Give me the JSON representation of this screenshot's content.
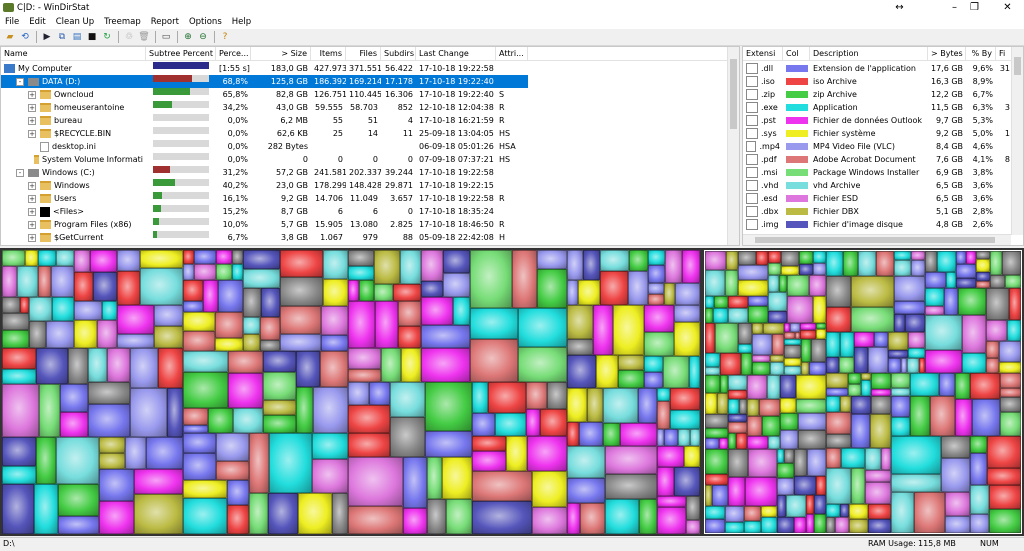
{
  "window": {
    "title": "C|D: - WinDirStat"
  },
  "menu": [
    "File",
    "Edit",
    "Clean Up",
    "Treemap",
    "Report",
    "Options",
    "Help"
  ],
  "toolbar_icons": [
    "open-icon",
    "refresh-icon",
    "select-icon",
    "copy-path-icon",
    "explorer-icon",
    "command-prompt-icon",
    "refresh-selected-icon",
    "recycle-icon",
    "delete-icon",
    "properties-icon",
    "zoom-in-icon",
    "zoom-out-icon",
    "help-icon"
  ],
  "tree": {
    "columns": [
      "Name",
      "Subtree Percent",
      "Perce...",
      "> Size",
      "Items",
      "Files",
      "Subdirs",
      "Last Change",
      "Attri..."
    ],
    "rows": [
      {
        "name": "My Computer",
        "indent": 0,
        "expander": "",
        "icon": "computer-icon",
        "bar_color": "#2b2b8c",
        "bar_pct": 100,
        "percent": "[1:55 s]",
        "size": "183,0 GB",
        "items": "427.973",
        "files": "371.551",
        "subdirs": "56.422",
        "last_change": "17-10-18 19:22:58",
        "attr": ""
      },
      {
        "name": "DATA (D:)",
        "indent": 1,
        "expander": "-",
        "icon": "drive-icon",
        "bar_color": "#a03030",
        "bar_pct": 69,
        "percent": "68,8%",
        "size": "125,8 GB",
        "items": "186.392",
        "files": "169.214",
        "subdirs": "17.178",
        "last_change": "17-10-18 19:22:40",
        "attr": "",
        "selected": true
      },
      {
        "name": "Owncloud",
        "indent": 2,
        "expander": "+",
        "icon": "cloud-folder-icon",
        "bar_color": "#3a9a3a",
        "bar_pct": 66,
        "percent": "65,8%",
        "size": "82,8 GB",
        "items": "126.751",
        "files": "110.445",
        "subdirs": "16.306",
        "last_change": "17-10-18 19:22:40",
        "attr": "S"
      },
      {
        "name": "homeuserantoine",
        "indent": 2,
        "expander": "+",
        "icon": "user-folder-icon",
        "bar_color": "#3a9a3a",
        "bar_pct": 34,
        "percent": "34,2%",
        "size": "43,0 GB",
        "items": "59.555",
        "files": "58.703",
        "subdirs": "852",
        "last_change": "12-10-18 12:04:38",
        "attr": "R"
      },
      {
        "name": "bureau",
        "indent": 2,
        "expander": "+",
        "icon": "desktop-folder-icon",
        "bar_color": "#3a9a3a",
        "bar_pct": 0,
        "percent": "0,0%",
        "size": "6,2 MB",
        "items": "55",
        "files": "51",
        "subdirs": "4",
        "last_change": "17-10-18 16:21:59",
        "attr": "R"
      },
      {
        "name": "$RECYCLE.BIN",
        "indent": 2,
        "expander": "+",
        "icon": "folder-icon",
        "bar_color": "#3a9a3a",
        "bar_pct": 0,
        "percent": "0,0%",
        "size": "62,6 KB",
        "items": "25",
        "files": "14",
        "subdirs": "11",
        "last_change": "25-09-18 13:04:05",
        "attr": "HS"
      },
      {
        "name": "desktop.ini",
        "indent": 2,
        "expander": "",
        "icon": "file-icon",
        "bar_color": "#3a9a3a",
        "bar_pct": 0,
        "percent": "0,0%",
        "size": "282 Bytes",
        "items": "",
        "files": "",
        "subdirs": "",
        "last_change": "06-09-18 05:01:26",
        "attr": "HSA"
      },
      {
        "name": "System Volume Informati",
        "indent": 2,
        "expander": "",
        "icon": "folder-icon",
        "bar_color": "#3a9a3a",
        "bar_pct": 0,
        "percent": "0,0%",
        "size": "0",
        "items": "0",
        "files": "0",
        "subdirs": "0",
        "last_change": "07-09-18 07:37:21",
        "attr": "HS"
      },
      {
        "name": "Windows (C:)",
        "indent": 1,
        "expander": "-",
        "icon": "drive-icon",
        "bar_color": "#a03030",
        "bar_pct": 31,
        "percent": "31,2%",
        "size": "57,2 GB",
        "items": "241.581",
        "files": "202.337",
        "subdirs": "39.244",
        "last_change": "17-10-18 19:22:58",
        "attr": ""
      },
      {
        "name": "Windows",
        "indent": 2,
        "expander": "+",
        "icon": "folder-icon",
        "bar_color": "#3a9a3a",
        "bar_pct": 40,
        "percent": "40,2%",
        "size": "23,0 GB",
        "items": "178.299",
        "files": "148.428",
        "subdirs": "29.871",
        "last_change": "17-10-18 19:22:15",
        "attr": ""
      },
      {
        "name": "Users",
        "indent": 2,
        "expander": "+",
        "icon": "folder-icon",
        "bar_color": "#3a9a3a",
        "bar_pct": 16,
        "percent": "16,1%",
        "size": "9,2 GB",
        "items": "14.706",
        "files": "11.049",
        "subdirs": "3.657",
        "last_change": "17-10-18 19:22:58",
        "attr": "R"
      },
      {
        "name": "<Files>",
        "indent": 2,
        "expander": "+",
        "icon": "files-icon",
        "bar_color": "#3a9a3a",
        "bar_pct": 15,
        "percent": "15,2%",
        "size": "8,7 GB",
        "items": "6",
        "files": "6",
        "subdirs": "0",
        "last_change": "17-10-18 18:35:24",
        "attr": ""
      },
      {
        "name": "Program Files (x86)",
        "indent": 2,
        "expander": "+",
        "icon": "folder-icon",
        "bar_color": "#3a9a3a",
        "bar_pct": 10,
        "percent": "10,0%",
        "size": "5,7 GB",
        "items": "15.905",
        "files": "13.080",
        "subdirs": "2.825",
        "last_change": "17-10-18 18:46:50",
        "attr": "R"
      },
      {
        "name": "$GetCurrent",
        "indent": 2,
        "expander": "+",
        "icon": "folder-icon",
        "bar_color": "#3a9a3a",
        "bar_pct": 7,
        "percent": "6,7%",
        "size": "3,8 GB",
        "items": "1.067",
        "files": "979",
        "subdirs": "88",
        "last_change": "05-09-18 22:42:08",
        "attr": "H"
      }
    ]
  },
  "extensions": {
    "columns": [
      "Extensi",
      "Col",
      "Description",
      "> Bytes",
      "% By",
      "Fi"
    ],
    "rows": [
      {
        "ext": ".dll",
        "color": "#7777ee",
        "desc": "Extension de l'application",
        "bytes": "17,6 GB",
        "pct": "9,6%",
        "files": "31"
      },
      {
        "ext": ".iso",
        "color": "#ee4444",
        "desc": "iso Archive",
        "bytes": "16,3 GB",
        "pct": "8,9%",
        "files": ""
      },
      {
        "ext": ".zip",
        "color": "#44cc44",
        "desc": "zip Archive",
        "bytes": "12,2 GB",
        "pct": "6,7%",
        "files": ""
      },
      {
        "ext": ".exe",
        "color": "#22dddd",
        "desc": "Application",
        "bytes": "11,5 GB",
        "pct": "6,3%",
        "files": "3"
      },
      {
        "ext": ".pst",
        "color": "#ee33ee",
        "desc": "Fichier de données Outlook",
        "bytes": "9,7 GB",
        "pct": "5,3%",
        "files": ""
      },
      {
        "ext": ".sys",
        "color": "#eeee22",
        "desc": "Fichier système",
        "bytes": "9,2 GB",
        "pct": "5,0%",
        "files": "1"
      },
      {
        "ext": ".mp4",
        "color": "#9999ee",
        "desc": "MP4 Video File (VLC)",
        "bytes": "8,4 GB",
        "pct": "4,6%",
        "files": ""
      },
      {
        "ext": ".pdf",
        "color": "#dd7777",
        "desc": "Adobe Acrobat Document",
        "bytes": "7,6 GB",
        "pct": "4,1%",
        "files": "8"
      },
      {
        "ext": ".msi",
        "color": "#77dd77",
        "desc": "Package Windows Installer",
        "bytes": "6,9 GB",
        "pct": "3,8%",
        "files": ""
      },
      {
        "ext": ".vhd",
        "color": "#77dddd",
        "desc": "vhd Archive",
        "bytes": "6,5 GB",
        "pct": "3,6%",
        "files": ""
      },
      {
        "ext": ".esd",
        "color": "#dd77dd",
        "desc": "Fichier ESD",
        "bytes": "6,5 GB",
        "pct": "3,6%",
        "files": ""
      },
      {
        "ext": ".dbx",
        "color": "#bbbb44",
        "desc": "Fichier DBX",
        "bytes": "5,1 GB",
        "pct": "2,8%",
        "files": ""
      },
      {
        "ext": ".img",
        "color": "#5555bb",
        "desc": "Fichier d'image disque",
        "bytes": "4,8 GB",
        "pct": "2,6%",
        "files": ""
      }
    ]
  },
  "status": {
    "path": "D:\\",
    "ram_label": "RAM Usage:",
    "ram_value": "115,8 MB",
    "num": "NUM"
  },
  "treemap": {
    "colors": [
      "#7777ee",
      "#ee4444",
      "#44cc44",
      "#22dddd",
      "#ee33ee",
      "#eeee22",
      "#9999ee",
      "#dd7777",
      "#77dd77",
      "#77dddd",
      "#dd77dd",
      "#bbbb44",
      "#5555bb",
      "#888888"
    ]
  }
}
